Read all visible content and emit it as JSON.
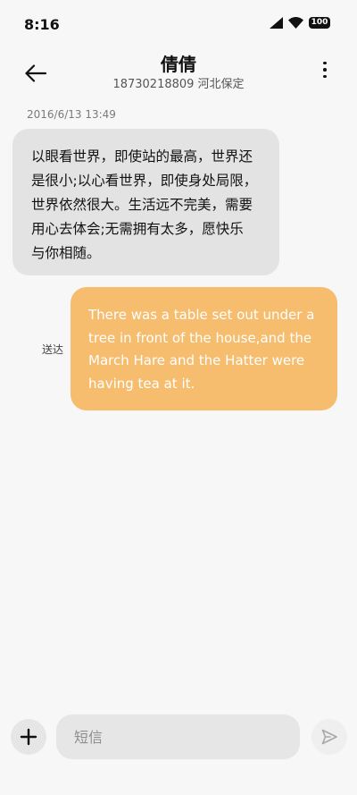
{
  "status_bar": {
    "time": "8:16",
    "battery": "100",
    "icons": [
      "signal-icon",
      "wifi-icon",
      "battery-icon"
    ]
  },
  "header": {
    "contact_name": "倩倩",
    "contact_number_location": "18730218809 河北保定",
    "icons": [
      "back-arrow-icon",
      "more-vertical-icon"
    ]
  },
  "conversation": {
    "timestamp": "2016/6/13 13:49",
    "messages": [
      {
        "direction": "incoming",
        "lines": [
          "以眼看世界，即使站的最高，世界还",
          "是很小;以心看世界，即使身处局限，",
          "世界依然很大。生活远不完美，需要",
          "用心去体会;无需拥有太多，愿快乐",
          "与你相随。"
        ]
      },
      {
        "direction": "outgoing",
        "status": "送达",
        "lines": [
          "There was a table set out under a",
          "tree in front of the house,and the",
          "March Hare and the Hatter were",
          "having tea at it."
        ]
      }
    ]
  },
  "composer": {
    "placeholder": "短信",
    "value": "",
    "icons": [
      "plus-icon",
      "send-icon"
    ]
  },
  "colors": {
    "background": "#f7f7f7",
    "incoming_bubble": "#e3e3e3",
    "outgoing_bubble": "#f6bd6e",
    "outgoing_text": "#ffffff",
    "input_background": "#e6e6e6"
  }
}
